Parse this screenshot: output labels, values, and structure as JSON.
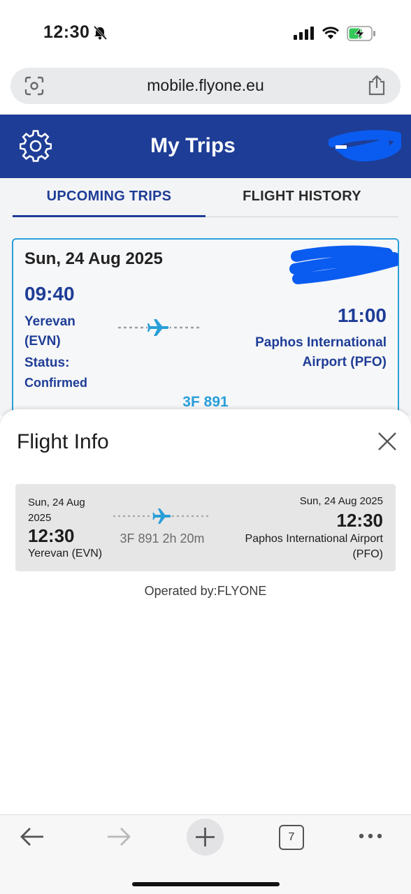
{
  "status_bar": {
    "time": "12:30"
  },
  "browser": {
    "url": "mobile.flyone.eu",
    "tab_count": "7"
  },
  "header": {
    "title": "My Trips"
  },
  "tabs": [
    {
      "label": "UPCOMING TRIPS",
      "active": true
    },
    {
      "label": "FLIGHT HISTORY",
      "active": false
    }
  ],
  "trip_card": {
    "date": "Sun, 24 Aug 2025",
    "departure_time": "09:40",
    "departure_city": "Yerevan (EVN)",
    "arrival_time": "11:00",
    "arrival_city": "Paphos International Airport (PFO)",
    "status_label": "Status:",
    "status_value": "Confirmed",
    "flight_number": "3F 891"
  },
  "flight_info": {
    "title": "Flight Info",
    "departure_date": "Sun, 24 Aug 2025",
    "departure_time": "12:30",
    "departure_city": "Yerevan (EVN)",
    "flight_summary": "3F 891 2h 20m",
    "arrival_date": "Sun, 24 Aug 2025",
    "arrival_time": "12:30",
    "arrival_city": "Paphos International Airport (PFO)",
    "operated_by": "Operated by:FLYONE"
  },
  "colors": {
    "brand_blue": "#1e3d96",
    "accent_cyan": "#2a9fd8",
    "redaction_blue": "#0a5cf0"
  },
  "icons": [
    "silent-bell-icon",
    "cellular-signal-icon",
    "wifi-icon",
    "battery-charging-icon",
    "lens-icon",
    "share-icon",
    "gear-icon",
    "plane-icon",
    "close-icon",
    "back-arrow-icon",
    "forward-arrow-icon",
    "plus-icon",
    "tabs-icon",
    "more-icon"
  ]
}
